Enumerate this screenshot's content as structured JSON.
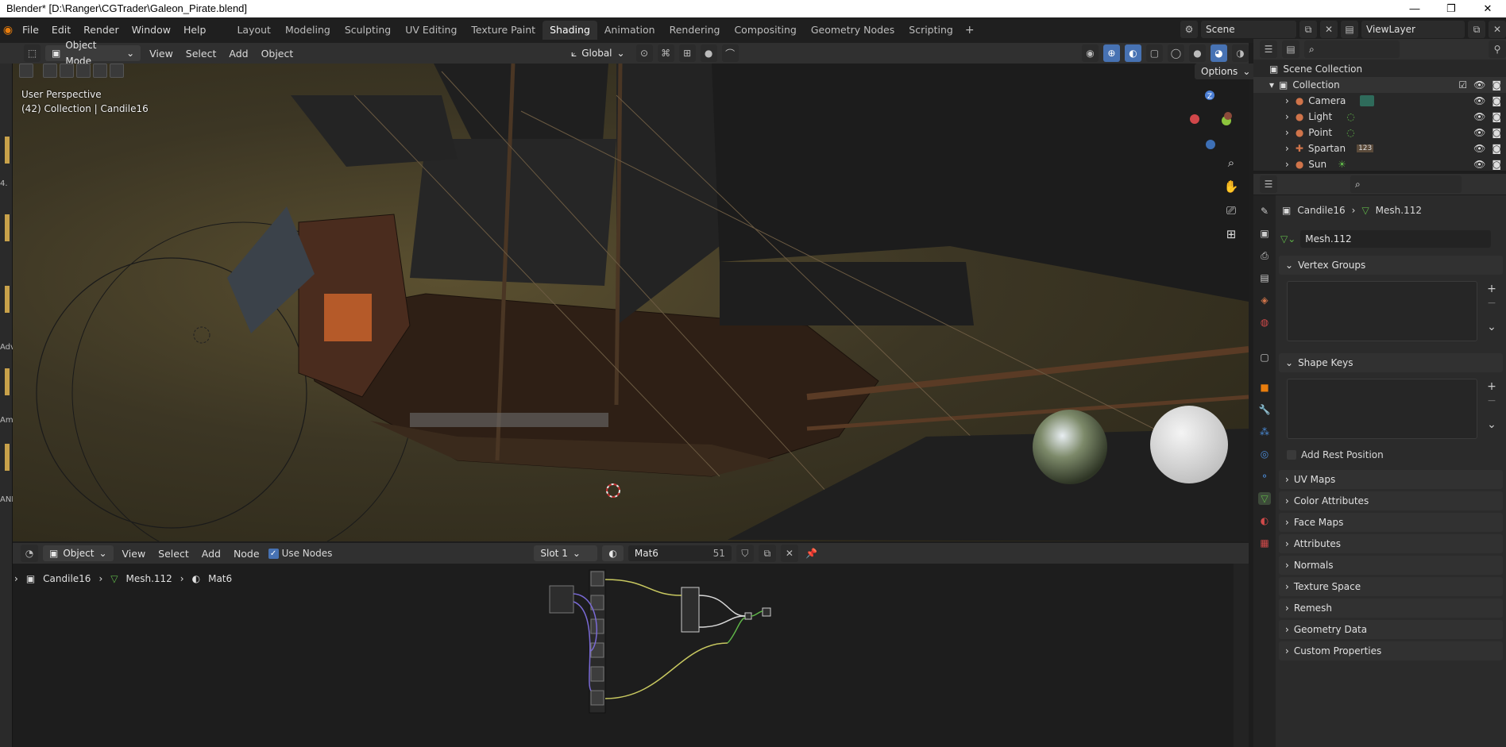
{
  "window": {
    "title": "Blender* [D:\\Ranger\\CGTrader\\Galeon_Pirate.blend]",
    "min": "—",
    "max": "❐",
    "close": "✕"
  },
  "menu": {
    "file": "File",
    "edit": "Edit",
    "render": "Render",
    "window": "Window",
    "help": "Help"
  },
  "workspaces": [
    "Layout",
    "Modeling",
    "Sculpting",
    "UV Editing",
    "Texture Paint",
    "Shading",
    "Animation",
    "Rendering",
    "Compositing",
    "Geometry Nodes",
    "Scripting"
  ],
  "scene": {
    "scene_name": "Scene",
    "view_layer": "ViewLayer"
  },
  "viewport": {
    "mode": "Object Mode",
    "menus": [
      "View",
      "Select",
      "Add",
      "Object"
    ],
    "transform": "Global",
    "options": "Options",
    "info_line1": "User Perspective",
    "info_line2": "(42) Collection | Candile16"
  },
  "gizmo": {
    "z": "Z"
  },
  "node_editor": {
    "type": "Object",
    "menus": [
      "View",
      "Select",
      "Add",
      "Node"
    ],
    "use_nodes": "Use Nodes",
    "slot": "Slot 1",
    "material": "Mat6",
    "users": "51",
    "breadcrumb": [
      "Candile16",
      "Mesh.112",
      "Mat6"
    ]
  },
  "outliner": {
    "root": "Scene Collection",
    "collection": "Collection",
    "items": [
      {
        "name": "Camera",
        "color": "#d0744a"
      },
      {
        "name": "Light",
        "color": "#d0744a"
      },
      {
        "name": "Point",
        "color": "#d0744a"
      },
      {
        "name": "Spartan",
        "color": "#d0744a"
      },
      {
        "name": "Sun",
        "color": "#d0744a"
      }
    ],
    "spartan_badge": "123"
  },
  "properties": {
    "object": "Candile16",
    "mesh": "Mesh.112",
    "mesh_field": "Mesh.112",
    "panels": {
      "vertex_groups": "Vertex Groups",
      "shape_keys": "Shape Keys",
      "add_rest": "Add Rest Position",
      "uv_maps": "UV Maps",
      "color_attributes": "Color Attributes",
      "face_maps": "Face Maps",
      "attributes": "Attributes",
      "normals": "Normals",
      "texture_space": "Texture Space",
      "remesh": "Remesh",
      "geometry_data": "Geometry Data",
      "custom_properties": "Custom Properties"
    }
  },
  "left_strip": {
    "l1": "4.",
    "l2": "Adv",
    "l3": "Am",
    "l4": "ANN"
  },
  "colors": {
    "accent": "#4772b3",
    "orange": "#e87d0d",
    "mesh_green": "#5fb548"
  }
}
